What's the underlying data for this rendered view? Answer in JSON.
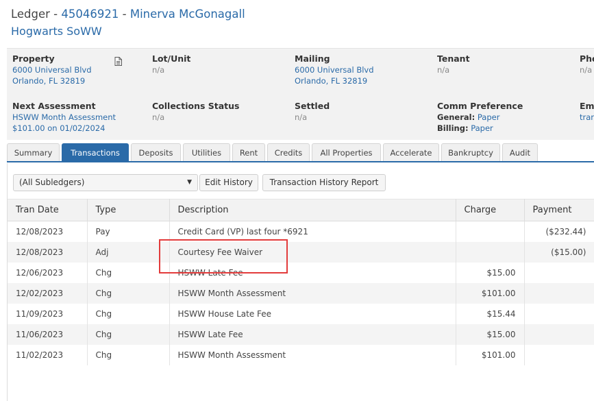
{
  "header": {
    "prefix": "Ledger - ",
    "account_number": "45046921",
    "separator": " - ",
    "owner_name": "Minerva McGonagall",
    "association": "Hogwarts SoWW"
  },
  "info": {
    "property": {
      "label": "Property",
      "line1": "6000 Universal Blvd",
      "line2": "Orlando, FL 32819",
      "icon": "document-icon"
    },
    "lot_unit": {
      "label": "Lot/Unit",
      "value": "n/a"
    },
    "mailing": {
      "label": "Mailing",
      "line1": "6000 Universal Blvd",
      "line2": "Orlando, FL 32819"
    },
    "tenant": {
      "label": "Tenant",
      "value": "n/a"
    },
    "phone": {
      "label": "Pho",
      "value": "n/a"
    },
    "next_assessment": {
      "label": "Next Assessment",
      "line1": "HSWW Month Assessment",
      "line2": "$101.00 on 01/02/2024"
    },
    "collections_status": {
      "label": "Collections Status",
      "value": "n/a"
    },
    "settled": {
      "label": "Settled",
      "value": "n/a"
    },
    "comm_preference": {
      "label": "Comm Preference",
      "general_label": "General:",
      "general_value": "Paper",
      "billing_label": "Billing:",
      "billing_value": "Paper"
    },
    "email": {
      "label": "Ema",
      "value": "trar"
    }
  },
  "tabs": [
    "Summary",
    "Transactions",
    "Deposits",
    "Utilities",
    "Rent",
    "Credits",
    "All Properties",
    "Accelerate",
    "Bankruptcy",
    "Audit"
  ],
  "active_tab": "Transactions",
  "toolbar": {
    "subledger_select": "(All Subledgers)",
    "edit_history": "Edit History",
    "report": "Transaction History Report"
  },
  "table": {
    "columns": [
      "Tran Date",
      "Type",
      "Description",
      "Charge",
      "Payment"
    ],
    "rows": [
      {
        "date": "12/08/2023",
        "type": "Pay",
        "description": "Credit Card (VP) last four *6921",
        "charge": "",
        "payment": "($232.44)"
      },
      {
        "date": "12/08/2023",
        "type": "Adj",
        "description": "Courtesy Fee Waiver",
        "charge": "",
        "payment": "($15.00)"
      },
      {
        "date": "12/06/2023",
        "type": "Chg",
        "description": "HSWW Late Fee",
        "charge": "$15.00",
        "payment": ""
      },
      {
        "date": "12/02/2023",
        "type": "Chg",
        "description": "HSWW Month Assessment",
        "charge": "$101.00",
        "payment": ""
      },
      {
        "date": "11/09/2023",
        "type": "Chg",
        "description": "HSWW House Late Fee",
        "charge": "$15.44",
        "payment": ""
      },
      {
        "date": "11/06/2023",
        "type": "Chg",
        "description": "HSWW Late Fee",
        "charge": "$15.00",
        "payment": ""
      },
      {
        "date": "11/02/2023",
        "type": "Chg",
        "description": "HSWW Month Assessment",
        "charge": "$101.00",
        "payment": ""
      }
    ]
  },
  "colors": {
    "accent": "#2a6aa8",
    "highlight": "#e23b3b",
    "panel_bg": "#f2f2f2"
  }
}
